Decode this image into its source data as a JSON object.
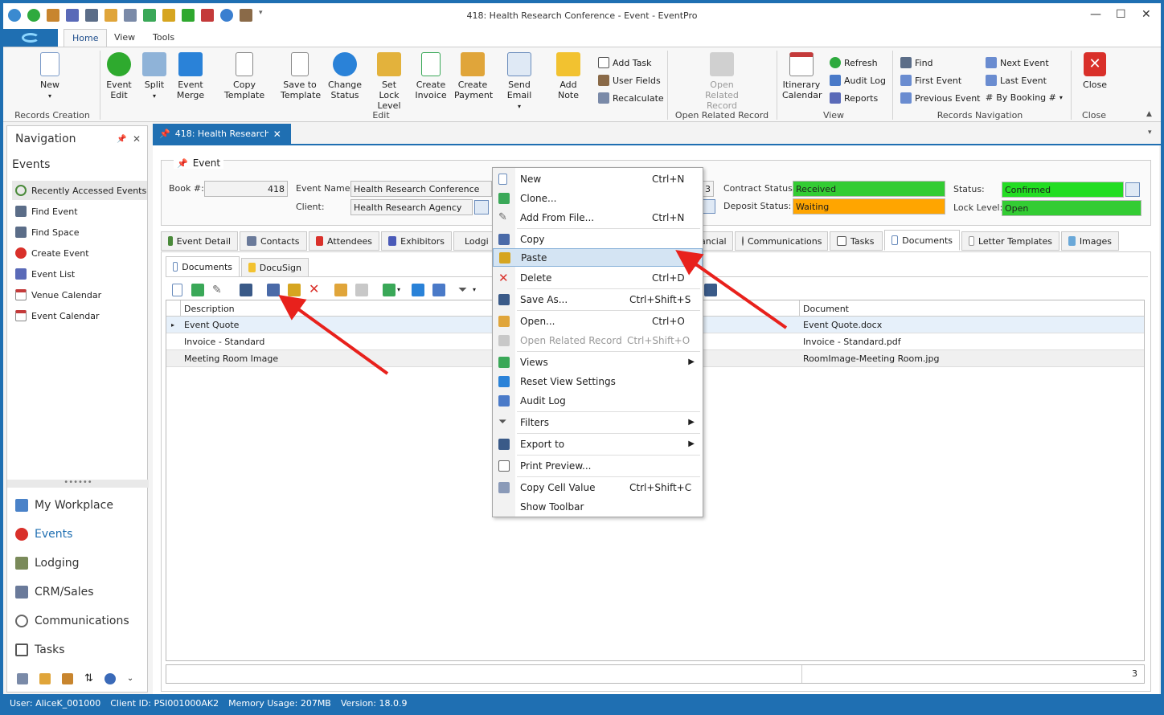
{
  "window": {
    "title": "418: Health Research Conference - Event - EventPro"
  },
  "ribbon_tabs": [
    "Home",
    "View",
    "Tools"
  ],
  "ribbon": {
    "new": "New",
    "event_edit": "Event Edit",
    "split": "Split",
    "event_merge": "Event Merge",
    "copy_template": "Copy Template",
    "save_to_template": "Save to Template",
    "change_status": "Change Status",
    "set_lock_level": "Set Lock Level",
    "create_invoice": "Create Invoice",
    "create_payment": "Create Payment",
    "send_email": "Send Email",
    "add_note": "Add Note",
    "add_task": "Add Task",
    "user_fields": "User Fields",
    "recalculate": "Recalculate",
    "open_related_record": "Open Related Record",
    "itinerary_calendar": "Itinerary Calendar",
    "refresh": "Refresh",
    "audit_log": "Audit Log",
    "reports": "Reports",
    "find": "Find",
    "first_event": "First Event",
    "previous_event": "Previous Event",
    "next_event": "Next Event",
    "last_event": "Last Event",
    "by_booking": "By Booking #",
    "close": "Close",
    "groups": {
      "records_creation": "Records Creation",
      "edit": "Edit",
      "open_related_record": "Open Related Record",
      "view": "View",
      "records_navigation": "Records Navigation",
      "close": "Close"
    }
  },
  "navigation": {
    "header": "Navigation",
    "section": "Events",
    "items": [
      "Recently Accessed Events",
      "Find Event",
      "Find Space",
      "Create Event",
      "Event List",
      "Venue Calendar",
      "Event Calendar"
    ],
    "modules": [
      "My Workplace",
      "Events",
      "Lodging",
      "CRM/Sales",
      "Communications",
      "Tasks"
    ]
  },
  "doc_tab": "418: Health Research C",
  "event": {
    "group_label": "Event",
    "book_label": "Book #:",
    "book_value": "418",
    "name_label": "Event Name:",
    "name_value": "Health Research Conference",
    "client_label": "Client:",
    "client_value": "Health Research Agency",
    "contract_label": "Contract Status:",
    "contract_value": "Received",
    "deposit_label": "Deposit Status:",
    "deposit_value": "Waiting",
    "status_label": "Status:",
    "status_value": "Confirmed",
    "lock_label": "Lock Level:",
    "lock_value": "Open",
    "partial_3a": "3",
    "partial_3b": "3",
    "partial_cal": "ancial"
  },
  "detail_tabs": [
    "Event Detail",
    "Contacts",
    "Attendees",
    "Exhibitors",
    "Lodgi",
    "Communications",
    "Tasks",
    "Documents",
    "Letter Templates",
    "Images"
  ],
  "sub_tabs": [
    "Documents",
    "DocuSign"
  ],
  "grid": {
    "columns": [
      "Description",
      "Document"
    ],
    "rows": [
      {
        "description": "Event Quote",
        "document": "Event Quote.docx"
      },
      {
        "description": "Invoice - Standard",
        "document": "Invoice - Standard.pdf"
      },
      {
        "description": "Meeting Room Image",
        "document": "RoomImage-Meeting Room.jpg"
      }
    ],
    "row_indicator": "▸",
    "count": "3"
  },
  "context_menu": [
    {
      "label": "New",
      "shortcut": "Ctrl+N"
    },
    {
      "label": "Clone...",
      "shortcut": ""
    },
    {
      "label": "Add From File...",
      "shortcut": "Ctrl+N"
    },
    {
      "label": "Copy",
      "shortcut": ""
    },
    {
      "label": "Paste",
      "shortcut": ""
    },
    {
      "label": "Delete",
      "shortcut": "Ctrl+D"
    },
    {
      "label": "Save As...",
      "shortcut": "Ctrl+Shift+S"
    },
    {
      "label": "Open...",
      "shortcut": "Ctrl+O"
    },
    {
      "label": "Open Related Record",
      "shortcut": "Ctrl+Shift+O"
    },
    {
      "label": "Views",
      "shortcut": ""
    },
    {
      "label": "Reset View Settings",
      "shortcut": ""
    },
    {
      "label": "Audit Log",
      "shortcut": ""
    },
    {
      "label": "Filters",
      "shortcut": ""
    },
    {
      "label": "Export to",
      "shortcut": ""
    },
    {
      "label": "Print Preview...",
      "shortcut": ""
    },
    {
      "label": "Copy Cell Value",
      "shortcut": "Ctrl+Shift+C"
    },
    {
      "label": "Show Toolbar",
      "shortcut": ""
    }
  ],
  "status_bar": {
    "user": "User: AliceK_001000",
    "client": "Client ID: PSI001000AK2",
    "memory": "Memory Usage: 207MB",
    "version": "Version: 18.0.9"
  },
  "colors": {
    "accent": "#1f6fb2",
    "received": "#33cc33",
    "waiting": "#ffa500",
    "confirmed": "#22dd22",
    "open": "#33cc33",
    "arrow": "#e8211c"
  }
}
